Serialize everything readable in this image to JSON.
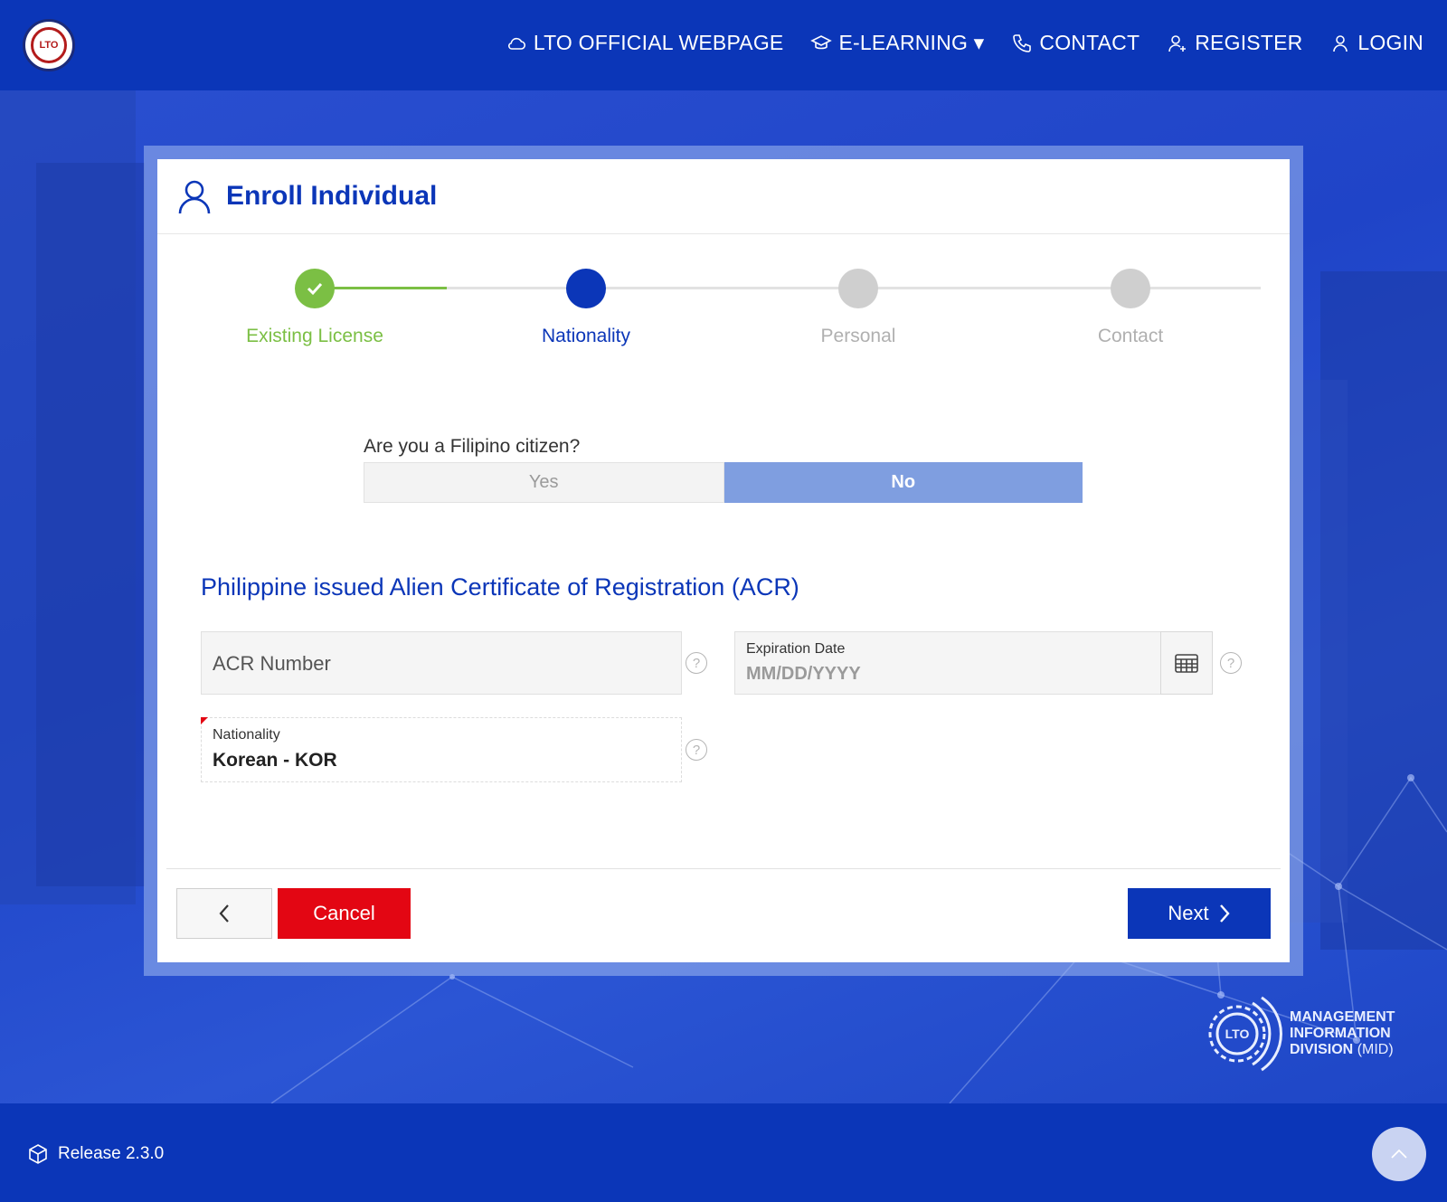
{
  "header": {
    "logo_text": "LTO",
    "nav": [
      {
        "label": "LTO OFFICIAL WEBPAGE",
        "icon": "cloud-icon"
      },
      {
        "label": "E-LEARNING ▾",
        "icon": "graduation-cap-icon"
      },
      {
        "label": "CONTACT",
        "icon": "phone-icon"
      },
      {
        "label": "REGISTER",
        "icon": "user-plus-icon"
      },
      {
        "label": "LOGIN",
        "icon": "user-icon"
      }
    ]
  },
  "card": {
    "title": "Enroll Individual",
    "steps": [
      {
        "label": "Existing License",
        "status": "complete"
      },
      {
        "label": "Nationality",
        "status": "active"
      },
      {
        "label": "Personal",
        "status": "pending"
      },
      {
        "label": "Contact",
        "status": "pending"
      }
    ],
    "question": "Are you a Filipino citizen?",
    "toggle": {
      "yes": "Yes",
      "no": "No",
      "selected": "No"
    },
    "section_title": "Philippine issued Alien Certificate of Registration (ACR)",
    "acr_number_placeholder": "ACR Number",
    "expiration": {
      "label": "Expiration Date",
      "placeholder": "MM/DD/YYYY"
    },
    "nationality": {
      "label": "Nationality",
      "value": "Korean - KOR"
    },
    "help_glyph": "?",
    "buttons": {
      "cancel": "Cancel",
      "next": "Next"
    }
  },
  "branding": {
    "mid_logo_text": "LTO",
    "mid_line1": "MANAGEMENT",
    "mid_line2": "INFORMATION",
    "mid_line3": "DIVISION",
    "mid_line3_suffix": "(MID)"
  },
  "footer": {
    "release": "Release 2.3.0"
  },
  "colors": {
    "primary": "#0b36b8",
    "success": "#7bbf44",
    "danger": "#e30613",
    "toggle_selected": "#7f9ee0",
    "pending": "#cfcfcf"
  }
}
